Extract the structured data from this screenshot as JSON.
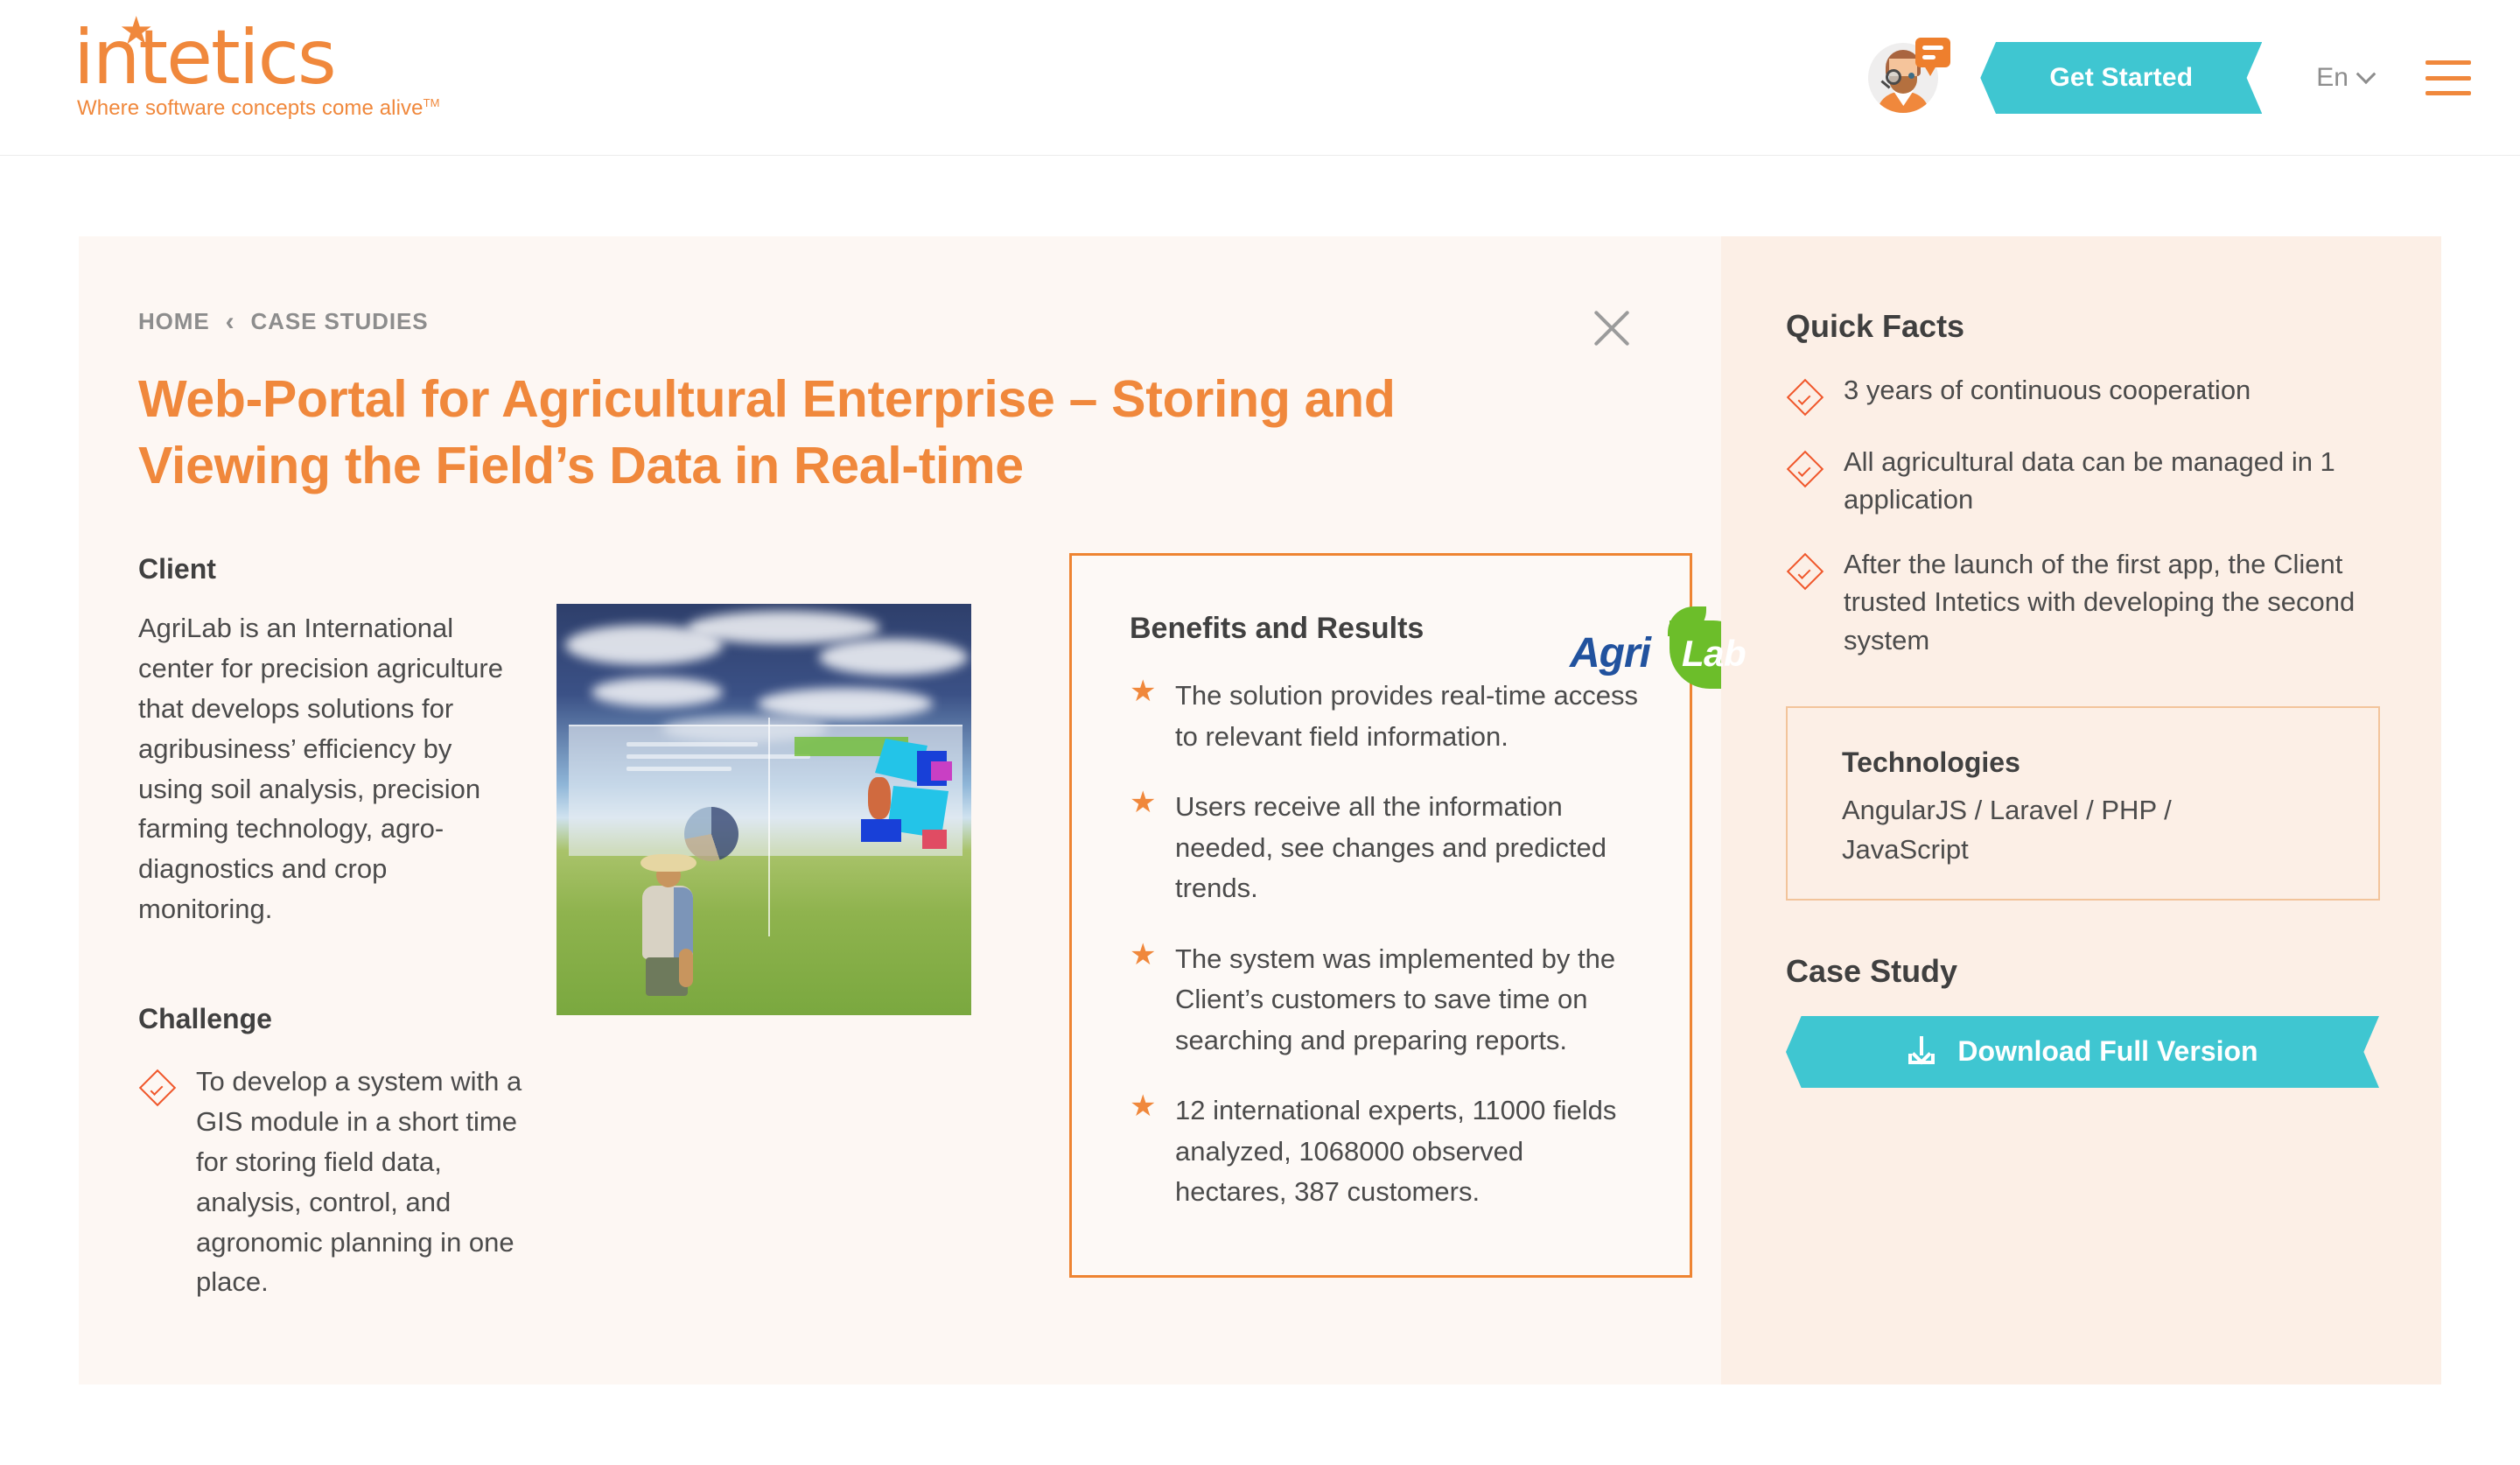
{
  "header": {
    "logo_text": "intetics",
    "logo_tagline": "Where software concepts come alive",
    "logo_tagline_tm": "TM",
    "cta_label": "Get Started",
    "language": "En",
    "avatar_icon": "support-agent-avatar-icon",
    "chat_badge_icon": "chat-bubble-icon",
    "menu_icon": "hamburger-menu-icon",
    "chevron_icon": "chevron-down-icon"
  },
  "breadcrumb": {
    "home": "HOME",
    "separator": "‹",
    "current": "CASE STUDIES"
  },
  "close_icon": "close-icon",
  "case": {
    "title": "Web-Portal for Agricultural Enterprise – Storing and Viewing the Field’s Data in Real-time",
    "client_logo_agri": "Agri",
    "client_logo_lab": "Lab",
    "client_heading": "Client",
    "client_text": "AgriLab is an International center for precision agriculture that develops solutions for agribusiness’ efficiency by using soil analysis, precision farming technology, agro-diagnostics and crop monitoring.",
    "challenge_heading": "Challenge",
    "challenge_items": [
      "To develop a system with a GIS module in a short time for storing field data, analysis, control, and agronomic planning in one place."
    ],
    "hero_image_alt": "farmer-in-wheat-field-with-data-dashboard-overlay"
  },
  "benefits": {
    "heading": "Benefits and Results",
    "items": [
      "The solution provides real-time access to relevant field information.",
      "Users receive all the information needed, see changes and predicted trends.",
      "The system was implemented by the Client’s customers to save time on searching and preparing reports.",
      "12 international experts, 11000 fields analyzed, 1068000 observed hectares, 387 customers."
    ],
    "bullet_glyph": "★"
  },
  "quick_facts": {
    "heading": "Quick Facts",
    "items": [
      "3 years of continuous cooperation",
      "All agricultural data can be managed in 1 application",
      "After the launch of the first app, the Client trusted Intetics with developing the second system"
    ],
    "bullet_icon": "diamond-check-icon"
  },
  "technologies": {
    "heading": "Technologies",
    "value": "AngularJS / Laravel / PHP / JavaScript"
  },
  "case_study": {
    "heading": "Case Study",
    "download_label": "Download Full Version",
    "download_icon": "download-icon"
  },
  "colors": {
    "brand_orange": "#F0883C",
    "accent_teal": "#3FC6D1",
    "diamond_orange": "#F0572B",
    "card_bg": "#FDF7F3",
    "sidebar_bg": "#FCEFE6",
    "logo_blue": "#21529E",
    "logo_green": "#6CBE2A"
  }
}
